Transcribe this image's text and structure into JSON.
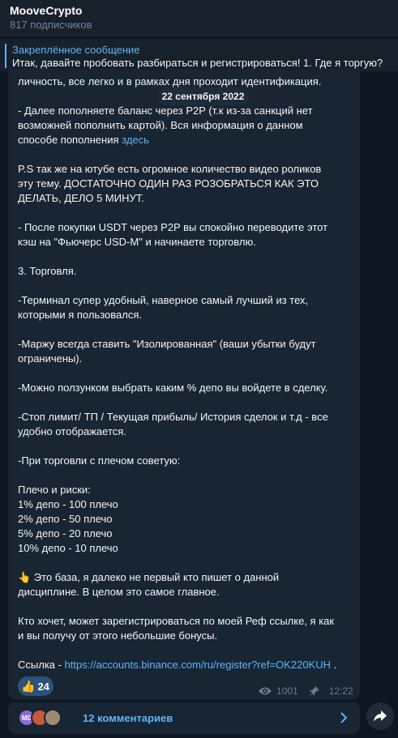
{
  "header": {
    "title": "MooveCrypto",
    "subscribers": "817 подписчиков"
  },
  "pinned": {
    "title": "Закреплённое сообщение",
    "text": "Итак, давайте пробовать разбираться и регистрироваться!  1. Где я торгую?"
  },
  "message": {
    "date": "22 сентября 2022",
    "lines": [
      "личность, все легко и в рамках дня проходит идентификация.",
      "- Далее пополняете баланс через P2P (т.к из-за санкций нет",
      "возможней пополнить картой). Вся информация о данном",
      "способе пополнения",
      "здесь",
      "P.S так же на ютубе есть огромное количество видео роликов",
      "эту тему. ДОСТАТОЧНО ОДИН РАЗ РОЗОБРАТЬСЯ КАК ЭТО",
      "ДЕЛАТЬ, ДЕЛО 5 МИНУТ.",
      "- После покупки USDT через P2P вы спокойно переводите этот",
      "кэш на \"Фьючерс USD-M\" и начинаете торговлю.",
      "3. Торговля.",
      "-Терминал супер удобный, наверное самый лучший из тех,",
      "которыми я пользовался.",
      "-Маржу всегда ставить \"Изолированная\" (ваши убытки будут",
      "ограничены).",
      "-Можно ползунком выбрать каким % депо вы войдете в сделку.",
      "-Стоп лимит/ ТП / Текущая прибыль/ История сделок и т.д - все",
      "удобно отображается.",
      "-При торговли с плечом советую:",
      "Плечо и риски:",
      "1% депо - 100 плечо",
      "2% депо - 50 плечо",
      "5% депо - 20 плечо",
      "10% депо - 10 плечо",
      "👆",
      " Это база, я далеко не первый кто пишет о данной",
      "дисциплине. В целом это самое главное.",
      "Кто хочет, может зарегистрироваться по моей Реф ссылке, я как",
      "и вы получу от этого небольшие бонусы.",
      "Ссылка - ",
      "https://accounts.binance.com/ru/register?ref=OK220KUH",
      " ."
    ],
    "reaction": {
      "emoji": "👍",
      "count": "24"
    },
    "views": "1001",
    "time": "12:22"
  },
  "comments": {
    "label": "12 комментариев",
    "avatar1_initials": "MD"
  },
  "colors": {
    "background": "#0e1621",
    "bubble": "#182533",
    "accent": "#5eb5f7",
    "header": "#17212b"
  },
  "icons": [
    "eye-icon",
    "pin-icon",
    "chevron-right-icon",
    "share-icon"
  ]
}
